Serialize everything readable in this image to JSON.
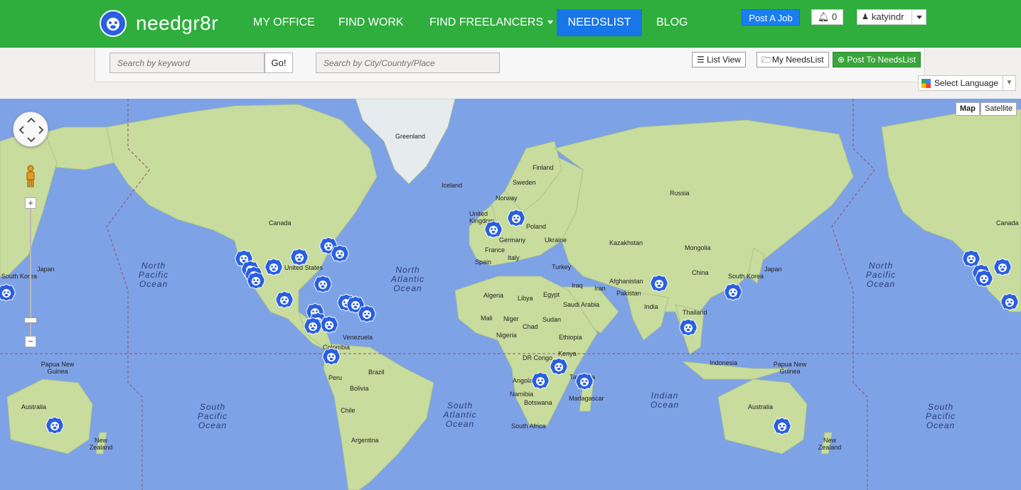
{
  "brand": {
    "name": "needgr8r"
  },
  "nav": {
    "links": [
      {
        "label": "MY OFFICE",
        "active": false
      },
      {
        "label": "FIND WORK",
        "active": false
      },
      {
        "label": "FIND FREELANCERS",
        "active": false,
        "dropdown": true
      },
      {
        "label": "NEEDSLIST",
        "active": true
      },
      {
        "label": "BLOG",
        "active": false
      }
    ],
    "post_job": "Post A Job",
    "notifications_count": "0",
    "username": "katyindr"
  },
  "search": {
    "keyword_placeholder": "Search by keyword",
    "go_label": "Go!",
    "place_placeholder": "Search by City/Country/Place"
  },
  "toolbar": {
    "list_view": "List View",
    "my_needslist": "My NeedsList",
    "post_needslist": "Post To NeedsList"
  },
  "language": {
    "label": "Select Language"
  },
  "map": {
    "type_buttons": {
      "map": "Map",
      "satellite": "Satellite"
    },
    "zoom_in": "+",
    "zoom_out": "−",
    "countries": [
      "Greenland",
      "Iceland",
      "Finland",
      "Sweden",
      "Norway",
      "Russia",
      "United Kingdom",
      "Poland",
      "Germany",
      "Ukraine",
      "France",
      "Italy",
      "Spain",
      "Turkey",
      "Kazakhstan",
      "Mongolia",
      "Canada",
      "United States",
      "Japan",
      "South Korea",
      "China",
      "Afghanistan",
      "Pakistan",
      "India",
      "Iraq",
      "Iran",
      "Saudi Arabia",
      "Egypt",
      "Libya",
      "Algeria",
      "Mali",
      "Niger",
      "Nigeria",
      "Chad",
      "Sudan",
      "Ethiopia",
      "Kenya",
      "DR Congo",
      "Tanzania",
      "Angola",
      "Namibia",
      "Botswana",
      "Madagascar",
      "South Africa",
      "Thailand",
      "Indonesia",
      "Papua New Guinea",
      "Australia",
      "New Zealand",
      "Venezuela",
      "Colombia",
      "Peru",
      "Brazil",
      "Bolivia",
      "Chile",
      "Argentina"
    ],
    "oceans": [
      "North Pacific Ocean",
      "North Atlantic Ocean",
      "South Pacific Ocean",
      "South Atlantic Ocean",
      "Indian Ocean"
    ]
  },
  "colors": {
    "nav_green": "#2fae3d",
    "active_blue": "#1976e8",
    "ocean": "#7ea2e6",
    "land": "#c7dc9d",
    "marker": "#2a5fe0"
  }
}
